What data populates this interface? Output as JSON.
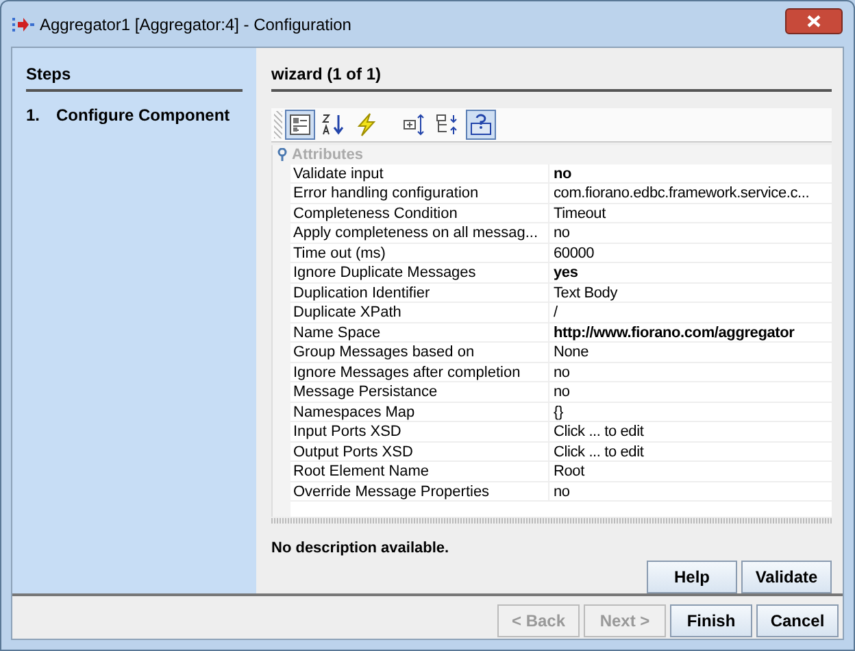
{
  "window": {
    "title": "Aggregator1 [Aggregator:4] - Configuration"
  },
  "steps": {
    "title": "Steps",
    "items": [
      {
        "number": "1.",
        "label": "Configure Component",
        "selected": true
      }
    ]
  },
  "wizard": {
    "title": "wizard (1 of 1)"
  },
  "toolbar": [
    {
      "kind": "categorized",
      "selected": true
    },
    {
      "kind": "sorted",
      "selected": false
    },
    {
      "kind": "bolt",
      "selected": false
    },
    {
      "kind": "expand",
      "selected": false
    },
    {
      "kind": "collapse",
      "selected": false
    },
    {
      "kind": "help",
      "selected": true
    }
  ],
  "properties": {
    "category": "Attributes",
    "rows": [
      {
        "name": "Validate input",
        "value": "no",
        "bold": true
      },
      {
        "name": "Error handling configuration",
        "value": "com.fiorano.edbc.framework.service.c...",
        "bold": false
      },
      {
        "name": "Completeness Condition",
        "value": "Timeout",
        "bold": false
      },
      {
        "name": "Apply completeness on all messag...",
        "value": "no",
        "bold": false
      },
      {
        "name": "Time out (ms)",
        "value": "60000",
        "bold": false
      },
      {
        "name": "Ignore Duplicate Messages",
        "value": "yes",
        "bold": true
      },
      {
        "name": "Duplication Identifier",
        "value": "Text Body",
        "bold": false
      },
      {
        "name": "Duplicate XPath",
        "value": "/",
        "bold": false
      },
      {
        "name": "Name Space",
        "value": "http://www.fiorano.com/aggregator",
        "bold": true
      },
      {
        "name": "Group Messages based on",
        "value": "None",
        "bold": false
      },
      {
        "name": "Ignore Messages after completion",
        "value": "no",
        "bold": false
      },
      {
        "name": "Message Persistance",
        "value": "no",
        "bold": false
      },
      {
        "name": "Namespaces Map",
        "value": "{}",
        "bold": false
      },
      {
        "name": "Input Ports XSD",
        "value": "Click ... to edit",
        "bold": false
      },
      {
        "name": "Output Ports XSD",
        "value": "Click ... to edit",
        "bold": false
      },
      {
        "name": "Root Element Name",
        "value": "Root",
        "bold": false
      },
      {
        "name": "Override Message Properties",
        "value": "no",
        "bold": false
      }
    ]
  },
  "description": "No description available.",
  "panel_buttons": [
    {
      "label": "Help",
      "disabled": false
    },
    {
      "label": "Validate",
      "disabled": false
    }
  ],
  "footer_buttons": [
    {
      "label": "< Back",
      "disabled": true
    },
    {
      "label": "Next >",
      "disabled": true
    },
    {
      "label": "Finish",
      "disabled": false
    },
    {
      "label": "Cancel",
      "disabled": false
    }
  ]
}
